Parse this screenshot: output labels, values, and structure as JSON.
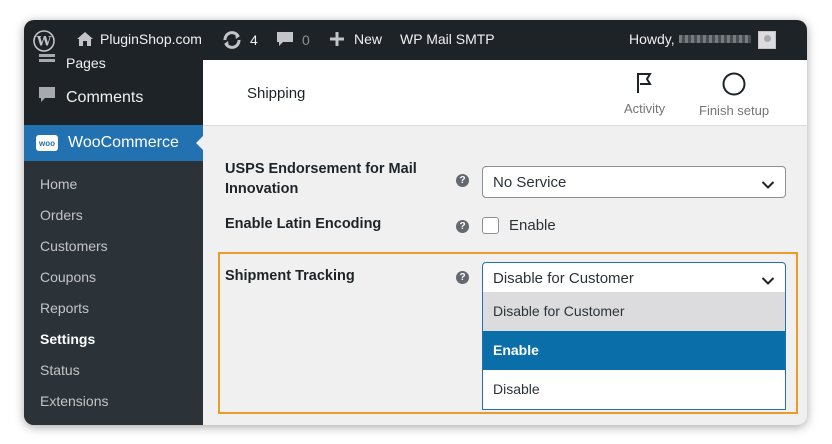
{
  "adminbar": {
    "site_name": "PluginShop.com",
    "updates_count": "4",
    "comments_count": "0",
    "new_label": "New",
    "plugin_label": "WP Mail SMTP",
    "howdy_label": "Howdy,"
  },
  "sidebar": {
    "pages_label": "Pages",
    "comments_label": "Comments",
    "woocommerce_label": "WooCommerce",
    "woo_badge": "woo",
    "submenu": [
      "Home",
      "Orders",
      "Customers",
      "Coupons",
      "Reports",
      "Settings",
      "Status",
      "Extensions"
    ],
    "current": "Settings"
  },
  "header": {
    "title": "Shipping",
    "activity_label": "Activity",
    "finish_setup_label": "Finish setup"
  },
  "form": {
    "usps_label": "USPS Endorsement for Mail Innovation",
    "usps_value": "No Service",
    "latin_label": "Enable Latin Encoding",
    "latin_checkbox_label": "Enable",
    "tracking_label": "Shipment Tracking",
    "tracking_value": "Disable for Customer",
    "tracking_options": [
      "Disable for Customer",
      "Enable",
      "Disable"
    ],
    "help_glyph": "?"
  },
  "colors": {
    "adminbar_bg": "#1d2327",
    "accent": "#2271b1",
    "highlight": "#ee9a2a",
    "selected_option": "#0a6ea8"
  }
}
